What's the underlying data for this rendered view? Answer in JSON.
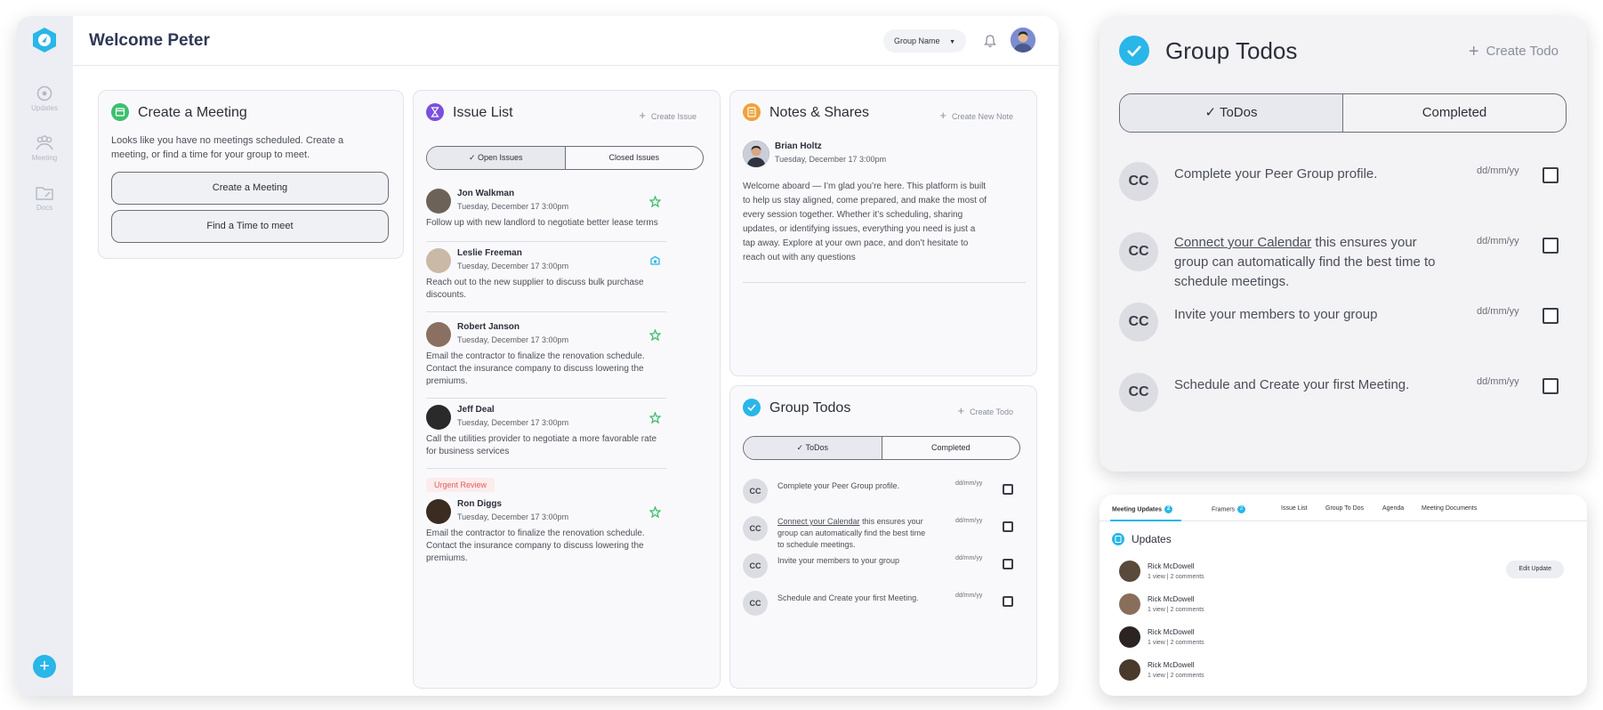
{
  "colors": {
    "accent": "#29b6e8",
    "green": "#3fbf6f",
    "purple": "#7b4fe0",
    "orange": "#f0a23b",
    "urgent": "#e15a5a"
  },
  "sidebar": {
    "items": [
      {
        "label": "Updates",
        "icon": "updates-icon"
      },
      {
        "label": "Meeting",
        "icon": "people-icon"
      },
      {
        "label": "Docs",
        "icon": "folder-icon"
      }
    ],
    "fab_label": "+"
  },
  "header": {
    "welcome": "Welcome Peter",
    "group_name": "Group Name"
  },
  "meeting": {
    "title": "Create a Meeting",
    "description": "Looks like you have no meetings scheduled. Create a meeting, or find a time for your group to meet.",
    "create_button": "Create a Meeting",
    "find_button": "Find a Time to meet"
  },
  "issues": {
    "title": "Issue List",
    "create_label": "Create  Issue",
    "tab_open": "Open Issues",
    "tab_closed": "Closed Issues",
    "urgent_label": "Urgent Review",
    "items": [
      {
        "name": "Jon Walkman",
        "date": "Tuesday, December 17 3:00pm",
        "text": "Follow up with new landlord to negotiate better lease terms"
      },
      {
        "name": "Leslie Freeman",
        "date": "Tuesday, December 17 3:00pm",
        "text": "Reach out to the new supplier to discuss bulk purchase discounts."
      },
      {
        "name": "Robert Janson",
        "date": "Tuesday, December 17 3:00pm",
        "text": "Email the contractor to finalize the renovation schedule. Contact the insurance company to discuss lowering the premiums."
      },
      {
        "name": "Jeff Deal",
        "date": "Tuesday, December 17 3:00pm",
        "text": "Call the utilities provider to negotiate a more favorable rate for business services"
      },
      {
        "name": "Ron Diggs",
        "date": "Tuesday, December 17 3:00pm",
        "text": "Email the contractor to finalize the renovation schedule. Contact the insurance company to discuss lowering the premiums."
      }
    ]
  },
  "notes": {
    "title": "Notes & Shares",
    "create_label": "Create New Note",
    "author": "Brian Holtz",
    "date": "Tuesday, December 17 3:00pm",
    "text": "Welcome aboard — I’m glad you’re here. This platform is built to help us stay aligned, come prepared, and make the most of every session together. Whether it’s scheduling, sharing updates, or identifying issues, everything you need is just a tap away. Explore at your own pace, and don’t hesitate to reach out with any questions"
  },
  "todos": {
    "title": "Group Todos",
    "create_label": "Create Todo",
    "tab_todos": "ToDos",
    "tab_completed": "Completed",
    "initials": "CC",
    "date_placeholder": "dd/mm/yy",
    "items": [
      {
        "text": "Complete your Peer Group profile.",
        "link": ""
      },
      {
        "text": " this ensures your group can automatically find the best time to schedule meetings.",
        "link": "Connect your Calendar"
      },
      {
        "text": "Invite your members to your group",
        "link": ""
      },
      {
        "text": "Schedule and Create your first Meeting.",
        "link": ""
      }
    ]
  },
  "updates": {
    "tabs": [
      {
        "label": "Meeting Updates",
        "badge": "2"
      },
      {
        "label": "Framers",
        "badge": "2"
      },
      {
        "label": "Issue List",
        "badge": ""
      },
      {
        "label": "Group To Dos",
        "badge": ""
      },
      {
        "label": "Agenda",
        "badge": ""
      },
      {
        "label": "Meeting Documents",
        "badge": ""
      }
    ],
    "title": "Updates",
    "edit_button": "Edit Update",
    "rows": [
      {
        "name": "Rick McDowell",
        "views": "1 view",
        "comments": "2 comments"
      },
      {
        "name": "Rick McDowell",
        "views": "1 view",
        "comments": "2 comments"
      },
      {
        "name": "Rick McDowell",
        "views": "1 view",
        "comments": "2 comments"
      },
      {
        "name": "Rick McDowell",
        "views": "1 view",
        "comments": "2 comments"
      }
    ]
  }
}
